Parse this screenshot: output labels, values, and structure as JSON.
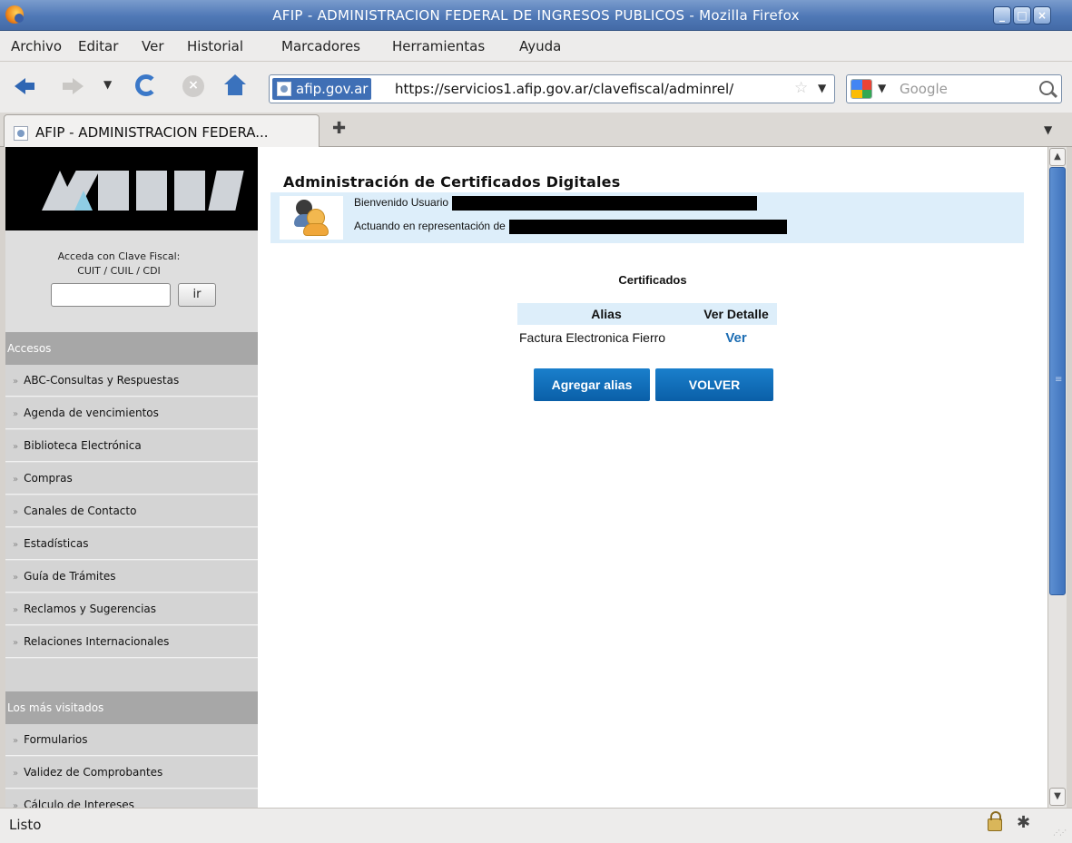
{
  "window": {
    "title": "AFIP - ADMINISTRACION FEDERAL DE INGRESOS PUBLICOS - Mozilla Firefox"
  },
  "menu": {
    "items": [
      "Archivo",
      "Editar",
      "Ver",
      "Historial",
      "Marcadores",
      "Herramientas",
      "Ayuda"
    ]
  },
  "urlbar": {
    "site": "afip.gov.ar",
    "url": "https://servicios1.afip.gov.ar/clavefiscal/adminrel/"
  },
  "search": {
    "placeholder": "Google"
  },
  "tab": {
    "label": "AFIP - ADMINISTRACION FEDERA..."
  },
  "sidebar": {
    "login_label_1": "Acceda con Clave Fiscal:",
    "login_label_2": "CUIT / CUIL / CDI",
    "login_button": "ir",
    "section_accesos": "Accesos",
    "accesos_items": [
      "ABC-Consultas y Respuestas",
      "Agenda de vencimientos",
      "Biblioteca Electrónica",
      "Compras",
      "Canales de Contacto",
      "Estadísticas",
      "Guía de Trámites",
      "Reclamos y Sugerencias",
      "Relaciones Internacionales"
    ],
    "section_visitados": "Los más visitados",
    "visitados_items": [
      "Formularios",
      "Validez de Comprobantes",
      "Cálculo de Intereses"
    ]
  },
  "main": {
    "title": "Administración de Certificados Digitales",
    "welcome": "Bienvenido Usuario",
    "acting": "Actuando en representación de",
    "cert_section": "Certificados",
    "table": {
      "headers": [
        "Alias",
        "Ver Detalle"
      ],
      "rows": [
        {
          "alias": "Factura Electronica Fierro",
          "link": "Ver"
        }
      ]
    },
    "buttons": {
      "add": "Agregar alias",
      "back": "VOLVER"
    }
  },
  "status": {
    "text": "Listo"
  }
}
